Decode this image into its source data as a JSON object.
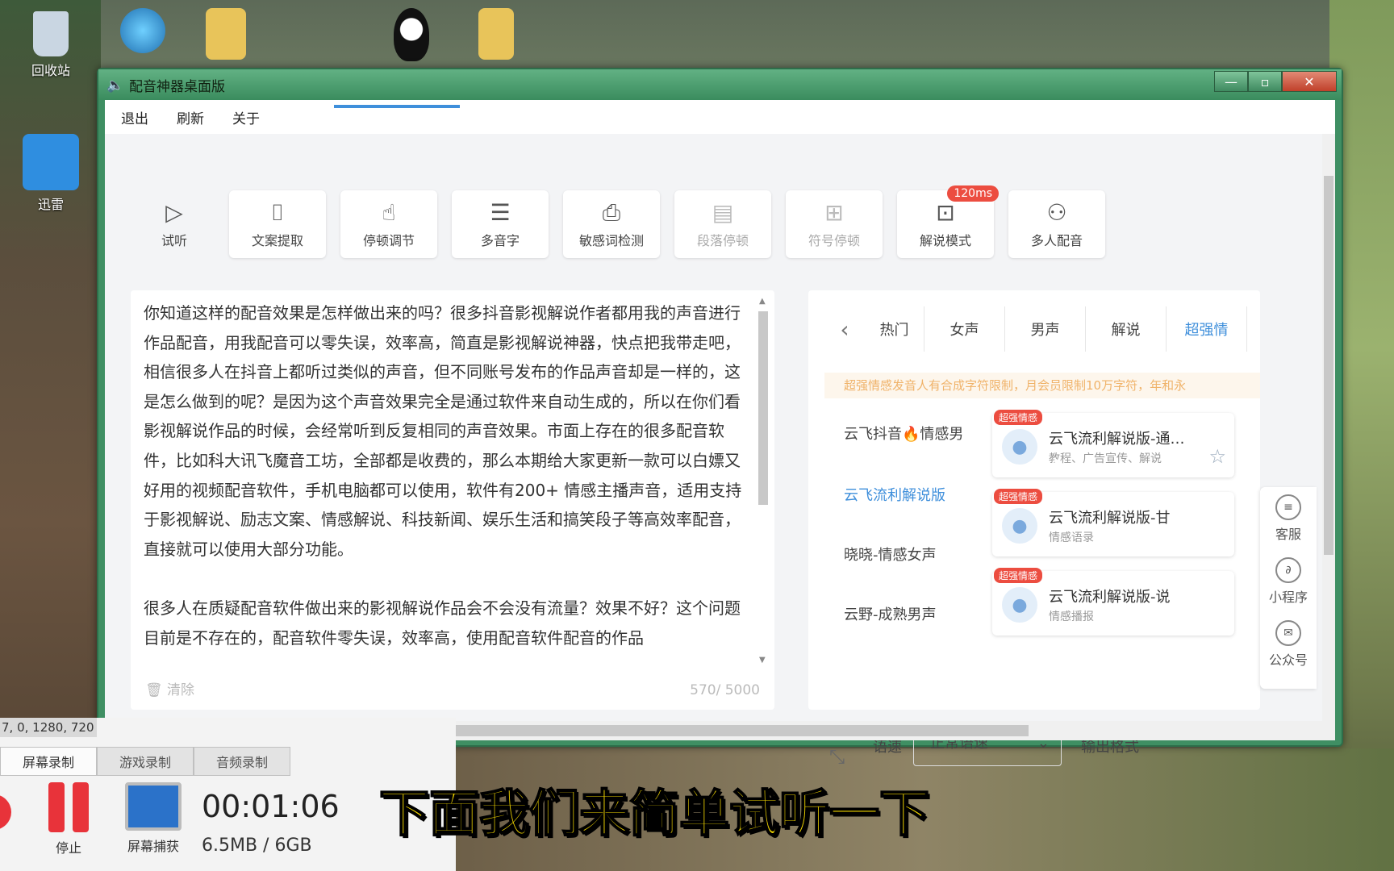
{
  "desktop": {
    "icons": [
      {
        "label": "回收站",
        "name": "recycle-bin-icon"
      },
      {
        "label": "迅雷",
        "name": "thunder-icon"
      }
    ],
    "coords_text": "7, 0, 1280, 720"
  },
  "window": {
    "title": "配音神器桌面版",
    "btn_min": "—",
    "btn_max": "▫",
    "btn_close": "✕"
  },
  "menu": {
    "exit": "退出",
    "refresh": "刷新",
    "about": "关于"
  },
  "toolbar": [
    {
      "label": "试听",
      "icon": "▷",
      "name": "preview-button",
      "dim": false
    },
    {
      "label": "文案提取",
      "icon": "⌷",
      "name": "text-extract-button",
      "dim": false
    },
    {
      "label": "停顿调节",
      "icon": "☝",
      "name": "pause-adjust-button",
      "dim": false
    },
    {
      "label": "多音字",
      "icon": "☰",
      "name": "polyphone-button",
      "dim": false
    },
    {
      "label": "敏感词检测",
      "icon": "⎙",
      "name": "sensitive-check-button",
      "dim": false
    },
    {
      "label": "段落停顿",
      "icon": "▤",
      "name": "paragraph-pause-button",
      "dim": true
    },
    {
      "label": "符号停顿",
      "icon": "⊞",
      "name": "symbol-pause-button",
      "dim": true
    },
    {
      "label": "解说模式",
      "icon": "⊡",
      "name": "narration-mode-button",
      "dim": false,
      "badge": "120ms"
    },
    {
      "label": "多人配音",
      "icon": "⚇",
      "name": "multi-voice-button",
      "dim": false
    }
  ],
  "editor": {
    "text": "你知道这样的配音效果是怎样做出来的吗？很多抖音影视解说作者都用我的声音进行作品配音，用我配音可以零失误，效率高，简直是影视解说神器，快点把我带走吧，相信很多人在抖音上都听过类似的声音，但不同账号发布的作品声音却是一样的，这是怎么做到的呢？是因为这个声音效果完全是通过软件来自动生成的，所以在你们看影视解说作品的时候，会经常听到反复相同的声音效果。市面上存在的很多配音软件，比如科大讯飞魔音工坊，全部都是收费的，那么本期给大家更新一款可以白嫖又好用的视频配音软件，手机电脑都可以使用，软件有200+ 情感主播声音，适用支持于影视解说、励志文案、情感解说、科技新闻、娱乐生活和搞笑段子等高效率配音，直接就可以使用大部分功能。\n\n很多人在质疑配音软件做出来的影视解说作品会不会没有流量？效果不好？这个问题目前是不存在的，配音软件零失误，效率高，使用配音软件配音的作品",
    "clear": "清除",
    "count": "570/ 5000"
  },
  "voices": {
    "tabs": [
      "热门",
      "女声",
      "男声",
      "解说",
      "超强情"
    ],
    "notice": "超强情感发音人有合成字符限制，月会员限制10万字符，年和永",
    "names": [
      {
        "label": "云飞抖音🔥情感男",
        "selected": false
      },
      {
        "label": "云飞流利解说版",
        "selected": true
      },
      {
        "label": "晓晓-情感女声",
        "selected": false
      },
      {
        "label": "云野-成熟男声",
        "selected": false
      }
    ],
    "cards": [
      {
        "tag": "超强情感",
        "title": "云飞流利解说版-通…",
        "desc": "教程、广告宣传、解说"
      },
      {
        "tag": "超强情感",
        "title": "云飞流利解说版-甘",
        "desc": "情感语录"
      },
      {
        "tag": "超强情感",
        "title": "云飞流利解说版-说",
        "desc": "情感播报"
      }
    ],
    "side": [
      {
        "label": "客服",
        "glyph": "≡"
      },
      {
        "label": "小程序",
        "glyph": "∂"
      },
      {
        "label": "公众号",
        "glyph": "✉"
      }
    ],
    "speed_label": "语速",
    "speed_value": "正常语速",
    "output_label": "输出格式"
  },
  "recorder": {
    "tabs": [
      "屏幕录制",
      "游戏录制",
      "音频录制"
    ],
    "stop": "停止",
    "capture": "屏幕捕获",
    "time": "00:01:06",
    "size": "6.5MB / 6GB"
  },
  "subtitle": "下面我们来简单试听一下"
}
